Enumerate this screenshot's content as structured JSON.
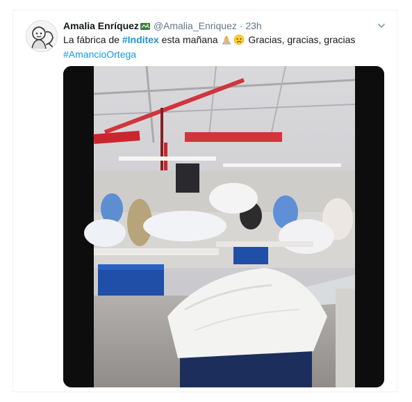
{
  "tweet": {
    "display_name": "Amalia Enríquez",
    "handle": "@Amalia_Enriquez",
    "separator": "·",
    "time": "23h",
    "text_prefix": "La fábrica de ",
    "hashtag_1": "#Inditex",
    "text_middle": " esta mañana ",
    "text_after_emoji": " Gracias, gracias, gracias",
    "hashtag_2": "#AmancioOrtega"
  },
  "icons": {
    "avatar": "avatar-illustration",
    "name_emoji": "emoji-icon",
    "more": "chevron-down-icon",
    "hands": "folded-hands-emoji-icon",
    "sad": "sad-face-emoji-icon"
  },
  "colors": {
    "link": "#1b95e0",
    "secondary_text": "#657786",
    "primary_text": "#14171a"
  }
}
